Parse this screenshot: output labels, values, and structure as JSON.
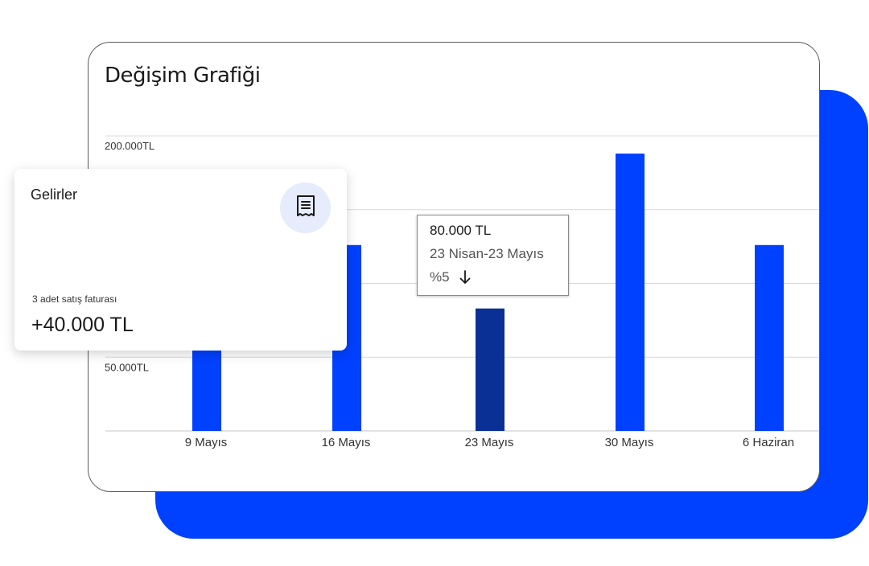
{
  "chart_title": "Değişim Grafiği",
  "chart_data": {
    "type": "bar",
    "categories": [
      "9 Mayıs",
      "16 Mayıs",
      "23  Mayıs",
      "30  Mayıs",
      "6 Haziran"
    ],
    "values": [
      110000,
      126000,
      83000,
      188000,
      126000
    ],
    "ylim": [
      0,
      200000
    ],
    "y_ticks": [
      {
        "label": "200.000TL",
        "value": 200000
      },
      {
        "label": "50.000TL",
        "value": 50000
      }
    ],
    "gridlines": [
      0,
      50000,
      100000,
      150000,
      200000
    ],
    "highlighted_index": 2,
    "grid": true,
    "colors": {
      "bar": "#0040ff",
      "highlight": "#0a3096",
      "grid": "#d9d9d9"
    }
  },
  "tooltip": {
    "value": "80.000 TL",
    "period": "23 Nisan-23 Mayıs",
    "change": "%5",
    "change_icon": "arrow-down-icon"
  },
  "income_card": {
    "title": "Gelirler",
    "icon": "receipt-icon",
    "subtitle": "3 adet satış faturası",
    "amount": "+40.000 TL"
  },
  "colors": {
    "accent": "#0040ff",
    "icon_bg": "#e6ecfb"
  }
}
